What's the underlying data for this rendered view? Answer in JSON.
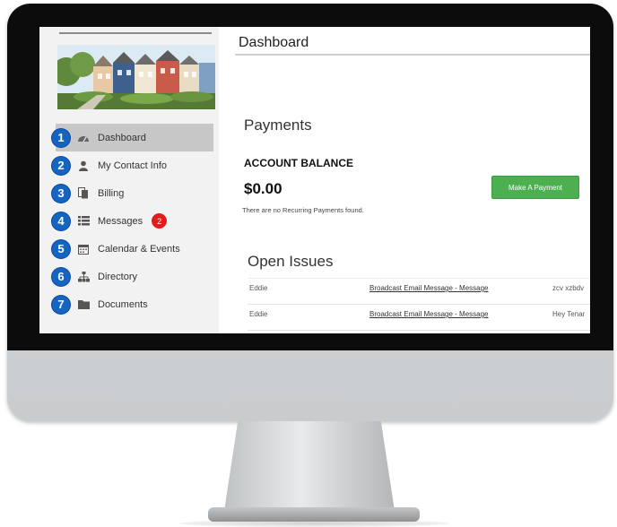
{
  "sidebar": {
    "items": [
      {
        "number": "1",
        "icon": "dashboard-icon",
        "label": "Dashboard",
        "active": true
      },
      {
        "number": "2",
        "icon": "user-icon",
        "label": "My Contact Info"
      },
      {
        "number": "3",
        "icon": "billing-icon",
        "label": "Billing"
      },
      {
        "number": "4",
        "icon": "list-icon",
        "label": "Messages",
        "count": "2"
      },
      {
        "number": "5",
        "icon": "calendar-icon",
        "label": "Calendar & Events"
      },
      {
        "number": "6",
        "icon": "sitemap-icon",
        "label": "Directory"
      },
      {
        "number": "7",
        "icon": "folder-icon",
        "label": "Documents"
      }
    ]
  },
  "main": {
    "title": "Dashboard",
    "payments": {
      "heading": "Payments",
      "balance_label": "ACCOUNT BALANCE",
      "balance_value": "$0.00",
      "button_label": "Make A Payment",
      "note": "There are no Recurring Payments found."
    },
    "issues": {
      "heading": "Open Issues",
      "rows": [
        {
          "name": "Eddie",
          "subject": "Broadcast Email Message - Message",
          "preview": "zcv xzbdv"
        },
        {
          "name": "Eddie",
          "subject": "Broadcast Email Message - Message",
          "preview": "Hey Tenar"
        }
      ]
    }
  },
  "colors": {
    "accent_green": "#4caf50",
    "number_badge_blue": "#1565c0",
    "count_badge_red": "#e51b1b",
    "active_item_bg": "#c7c7c7"
  }
}
